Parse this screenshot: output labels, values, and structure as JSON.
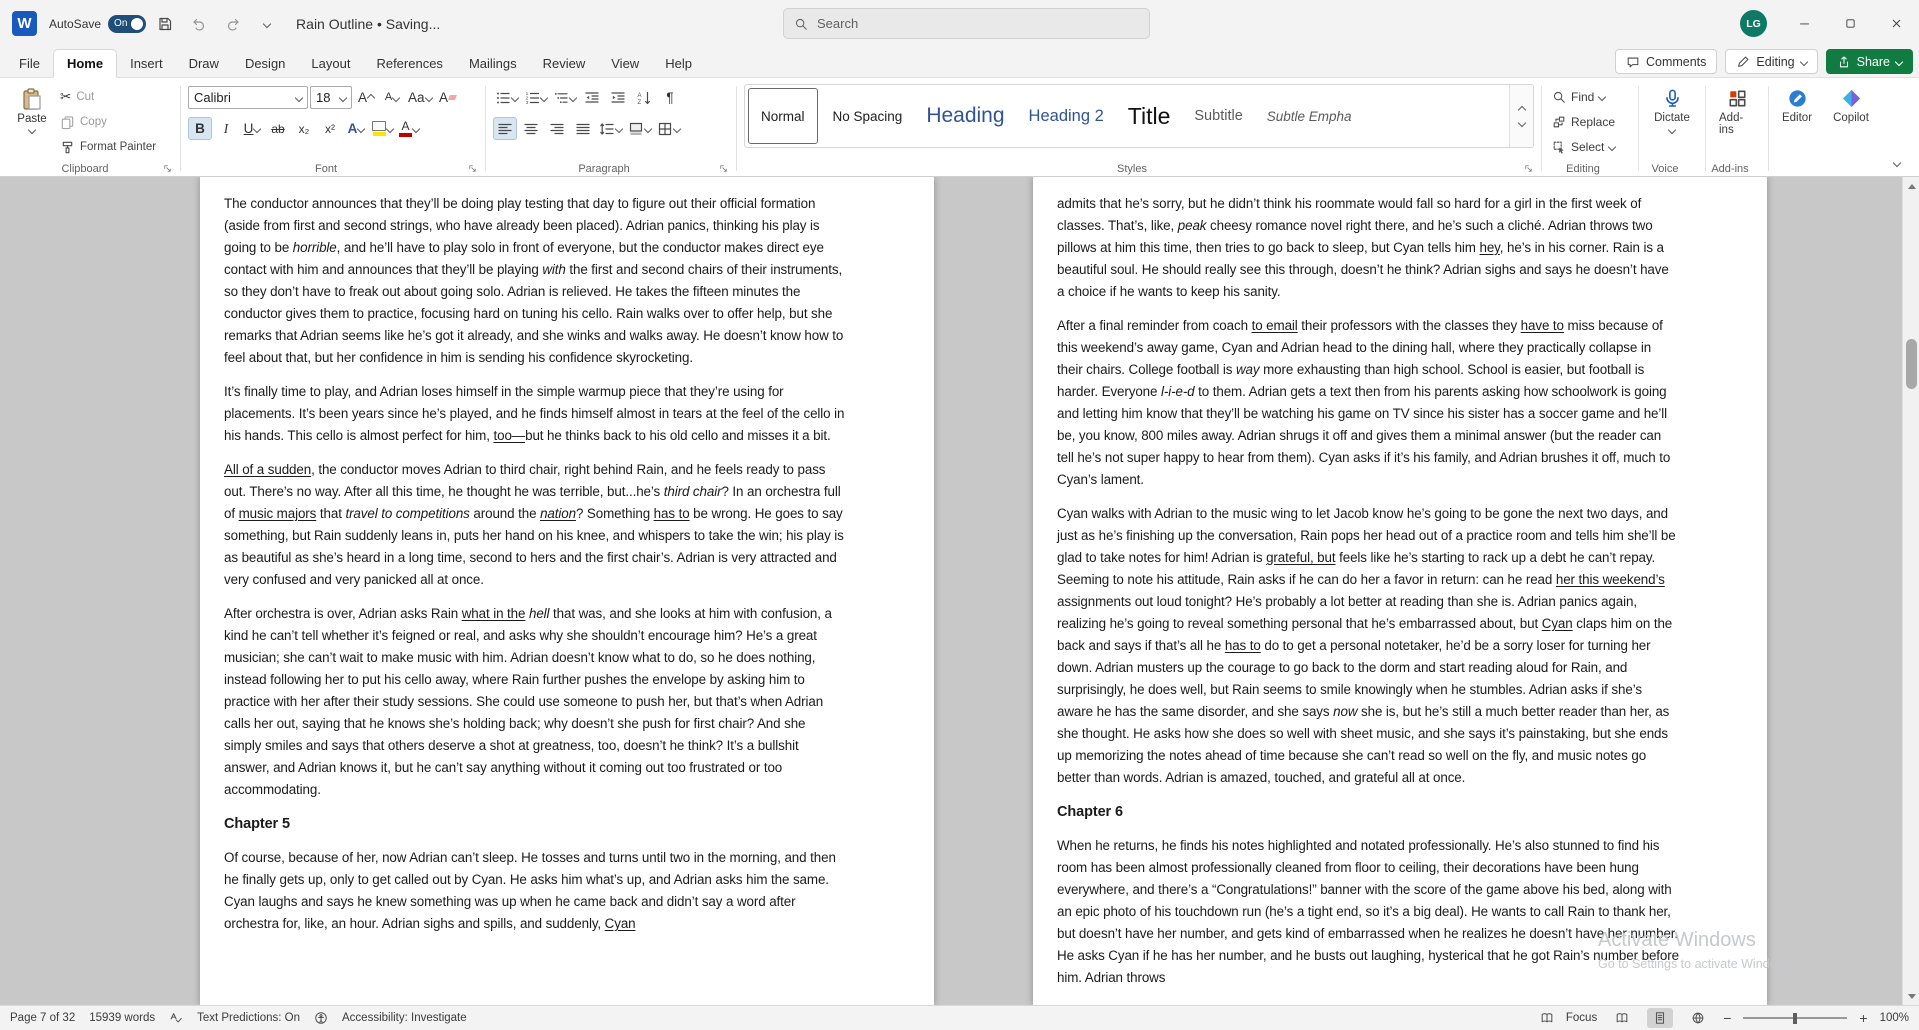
{
  "colors": {
    "share_green": "#107C41",
    "style_heading_blue": "#2F5496",
    "autosave_toggle_blue": "#1F4E79",
    "avatar_teal": "#0E7A66",
    "font_color_red": "#C00000",
    "highlight_yellow": "#FFE200"
  },
  "titlebar": {
    "autosave_label": "AutoSave",
    "autosave_state": "On",
    "doc_title": "Rain Outline • Saving...",
    "search_placeholder": "Search",
    "avatar_initials": "LG"
  },
  "tabs": {
    "items": [
      "File",
      "Home",
      "Insert",
      "Draw",
      "Design",
      "Layout",
      "References",
      "Mailings",
      "Review",
      "View",
      "Help"
    ],
    "active": "Home",
    "comments": "Comments",
    "editing_mode": "Editing",
    "share": "Share"
  },
  "ribbon": {
    "clipboard": {
      "label": "Clipboard",
      "paste": "Paste",
      "cut": "Cut",
      "copy": "Copy",
      "format_painter": "Format Painter"
    },
    "font": {
      "label": "Font",
      "family": "Calibri",
      "size": "18",
      "bold": "B",
      "italic": "I",
      "underline": "U",
      "strike": "ab",
      "sub": "x₂",
      "sup": "x²",
      "effects": "A",
      "case_label": "Aa",
      "clear": "A",
      "grow": "A",
      "shrink": "A",
      "color_label": "A"
    },
    "paragraph": {
      "label": "Paragraph",
      "pilcrow": "¶"
    },
    "styles": {
      "label": "Styles",
      "items": [
        "Normal",
        "No Spacing",
        "Heading",
        "Heading 2",
        "Title",
        "Subtitle",
        "Subtle Empha"
      ]
    },
    "editing": {
      "label": "Editing",
      "find": "Find",
      "replace": "Replace",
      "select": "Select"
    },
    "voice": {
      "label": "Voice",
      "dictate": "Dictate"
    },
    "addins": {
      "label": "Add-ins",
      "button": "Add-ins"
    },
    "editor": {
      "button": "Editor"
    },
    "copilot": {
      "button": "Copilot"
    }
  },
  "document": {
    "left_page": [
      {
        "style": "body",
        "runs": [
          {
            "t": "The conductor announces that they’ll be doing play testing that day to figure out their official formation (aside from first and second strings, who have already been placed). Adrian panics, thinking his play is going to be "
          },
          {
            "t": "horrible",
            "i": true
          },
          {
            "t": ", and he’ll have to play solo in front of everyone, but the conductor makes direct eye contact with him and announces that they’ll be playing "
          },
          {
            "t": "with",
            "i": true
          },
          {
            "t": " the first and second chairs of their instruments, so they don’t have to freak out about going solo. Adrian is relieved. He takes the fifteen minutes the conductor gives them to practice, focusing hard on tuning his cello. Rain walks over to offer help, but she remarks that Adrian seems like he’s got it already, and she winks and walks away. He doesn’t know how to feel about that, but her confidence in him is sending his confidence skyrocketing."
          }
        ]
      },
      {
        "style": "body",
        "runs": [
          {
            "t": "It’s finally time to play, and Adrian loses himself in the simple warmup piece that they’re using for placements. It’s been years since he’s played, and he finds himself almost in tears at the feel of the cello in his hands. This cello is almost perfect for him, "
          },
          {
            "t": "too—",
            "u": true
          },
          {
            "t": "but he thinks back to his old cello and misses it a bit."
          }
        ]
      },
      {
        "style": "body",
        "runs": [
          {
            "t": "All of a sudden",
            "u": true
          },
          {
            "t": ", the conductor moves Adrian to third chair, right behind Rain, and he feels ready to pass out. There’s no way. After all this time, he thought he was terrible, but...he’s "
          },
          {
            "t": "third chair",
            "i": true
          },
          {
            "t": "? In an orchestra full of "
          },
          {
            "t": "music majors",
            "u": true
          },
          {
            "t": " that "
          },
          {
            "t": "travel to competitions",
            "i": true
          },
          {
            "t": " around the "
          },
          {
            "t": "nation",
            "i": true,
            "u": true
          },
          {
            "t": "? Something "
          },
          {
            "t": "has to",
            "u": true
          },
          {
            "t": " be wrong. He goes to say something, but Rain suddenly leans in, puts her hand on his knee, and whispers to take the win; his play is as beautiful as she’s heard in a long time, second to hers and the first chair’s. Adrian is very attracted and very confused and very panicked all at once."
          }
        ]
      },
      {
        "style": "body",
        "runs": [
          {
            "t": "After orchestra is over, Adrian asks Rain "
          },
          {
            "t": "what in the",
            "u": true
          },
          {
            "t": " "
          },
          {
            "t": "hell",
            "i": true
          },
          {
            "t": " that was, and she looks at him with confusion, a kind he can’t tell whether it’s feigned or real, and asks why she shouldn’t encourage him? He’s a great musician; she can’t wait to make music with him. Adrian doesn’t know what to do, so he does nothing, instead following her to put his cello away, where Rain further pushes the envelope by asking him to practice with her after their study sessions. She could use someone to push her, but that’s when Adrian calls her out, saying that he knows she’s holding back; why doesn’t she push for first chair? And she simply smiles and says that others deserve a shot at greatness, too, doesn’t he think? It’s a bullshit answer, and Adrian knows it, but he can’t say anything without it coming out too frustrated or too accommodating."
          }
        ]
      },
      {
        "style": "heading",
        "runs": [
          {
            "t": "Chapter 5"
          }
        ]
      },
      {
        "style": "body",
        "runs": [
          {
            "t": "Of course, because of her, now Adrian can’t sleep. He tosses and turns until two in the morning, and then he finally gets up, only to get called out by Cyan. He asks him what’s up, and Adrian asks him the same. Cyan laughs and says he knew something was up when he came back and didn’t say a word after orchestra for, like, an hour. Adrian sighs and spills, and suddenly, "
          },
          {
            "t": "Cyan",
            "u": true
          }
        ]
      }
    ],
    "right_page": [
      {
        "style": "body",
        "runs": [
          {
            "t": "admits that he’s sorry, but he didn’t think his roommate would fall so hard for a girl in the first week of classes. That’s, like, "
          },
          {
            "t": "peak",
            "i": true
          },
          {
            "t": " cheesy romance novel right there, and he’s such a cliché. Adrian throws two pillows at him this time, then tries to go back to sleep, but Cyan tells him "
          },
          {
            "t": "hey",
            "u": true
          },
          {
            "t": ", he’s in his corner. Rain is a beautiful soul. He should really see this through, doesn’t he think? Adrian sighs and says he doesn’t have a choice if he wants to keep his sanity."
          }
        ]
      },
      {
        "style": "body",
        "runs": [
          {
            "t": "After a final reminder from coach "
          },
          {
            "t": "to email",
            "u": true
          },
          {
            "t": " their professors with the classes they "
          },
          {
            "t": "have to",
            "u": true
          },
          {
            "t": " miss because of this weekend’s away game, Cyan and Adrian head to the dining hall, where they practically collapse in their chairs. College football is "
          },
          {
            "t": "way",
            "i": true
          },
          {
            "t": " more exhausting than high school. School is easier, but football is harder. Everyone "
          },
          {
            "t": "l-i-e-d",
            "i": true
          },
          {
            "t": " to them. Adrian gets a text then from his parents asking how schoolwork is going and letting him know that they’ll be watching his game on TV since his sister has a soccer game and he’ll be, you know, 800 miles away. Adrian shrugs it off and gives them a minimal answer (but the reader can tell he’s not super happy to hear from them). Cyan asks if it’s his family, and Adrian brushes it off, much to Cyan’s lament."
          }
        ]
      },
      {
        "style": "body",
        "runs": [
          {
            "t": "Cyan walks with Adrian to the music wing to let Jacob know he’s going to be gone the next two days, and just as he’s finishing up the conversation, Rain pops her head out of a practice room and tells him she’ll be glad to take notes for him! Adrian is "
          },
          {
            "t": "grateful, but",
            "u": true
          },
          {
            "t": " feels like he’s starting to rack up a debt he can’t repay. Seeming to note his attitude, Rain asks if he can do her a favor in return: can he read "
          },
          {
            "t": "her this weekend’s",
            "u": true
          },
          {
            "t": " assignments out loud tonight? He’s probably a lot better at reading than she is. Adrian panics again, realizing he’s going to reveal something personal that he’s embarrassed about, but "
          },
          {
            "t": "Cyan",
            "u": true
          },
          {
            "t": " claps him on the back and says if that’s all he "
          },
          {
            "t": "has to",
            "u": true
          },
          {
            "t": " do to get a personal notetaker, he’d be a sorry loser for turning her down. Adrian musters up the courage to go back to the dorm and start reading aloud for Rain, and surprisingly, he does well, but Rain seems to smile knowingly when he stumbles. Adrian asks if she’s aware he has the same disorder, and she says "
          },
          {
            "t": "now",
            "i": true
          },
          {
            "t": " she is, but he’s still a much better reader than her, as she thought. He asks how she does so well with sheet music, and she says it’s painstaking, but she ends up memorizing the notes ahead of time because she can’t read so well on the fly, and music notes go better than words. Adrian is amazed, touched, and grateful all at once."
          }
        ]
      },
      {
        "style": "heading",
        "runs": [
          {
            "t": "Chapter 6"
          }
        ]
      },
      {
        "style": "body",
        "runs": [
          {
            "t": "When he returns, he finds his notes highlighted and notated professionally. He’s also stunned to find his room has been almost professionally cleaned from floor to ceiling, their decorations have been hung everywhere, and there’s a “Congratulations!” banner with the score of the game above his bed, along with an epic photo of his touchdown run (he’s a tight end, so it’s a big deal). He wants to call Rain to thank her, but doesn’t have her number, and gets kind of embarrassed when he realizes he doesn’t have her number. He asks Cyan if he has her number, and he busts out laughing, hysterical that he got Rain’s number before him. Adrian throws"
          }
        ]
      }
    ]
  },
  "watermark": {
    "line1": "Activate Windows",
    "line2": "Go to Settings to activate Windows."
  },
  "statusbar": {
    "page_info": "Page 7 of 32",
    "word_count": "15939 words",
    "text_predictions": "Text Predictions: On",
    "accessibility": "Accessibility: Investigate",
    "focus": "Focus",
    "zoom_out": "−",
    "zoom_in": "+",
    "zoom_level": "100%"
  }
}
